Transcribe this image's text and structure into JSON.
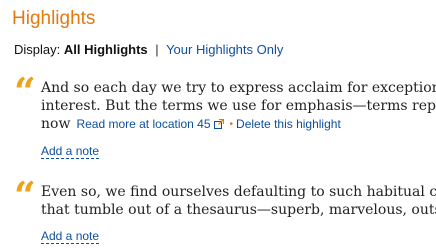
{
  "header": {
    "title": "Highlights"
  },
  "display": {
    "label": "Display:",
    "current": "All Highlights",
    "separator": "|",
    "other_option": "Your Highlights Only"
  },
  "highlights": [
    {
      "lines": [
        "And so each day we try to express acclaim for exception",
        "interest. But the terms we use for emphasis—terms rep",
        "now"
      ],
      "read_more": "Read more at location 45",
      "delete": "Delete this highlight",
      "add_note": "Add a note"
    },
    {
      "lines": [
        "Even so, we find ourselves defaulting to such habitual cl",
        "that tumble out of a thesaurus—superb, marvelous, outs"
      ],
      "add_note": "Add a note"
    }
  ],
  "icons": {
    "quote": "opening-quote-icon",
    "external": "external-link-icon"
  },
  "colors": {
    "title": "#e47911",
    "quote_mark": "#f0a11c",
    "link": "#0e4f9c",
    "text": "#222222"
  }
}
